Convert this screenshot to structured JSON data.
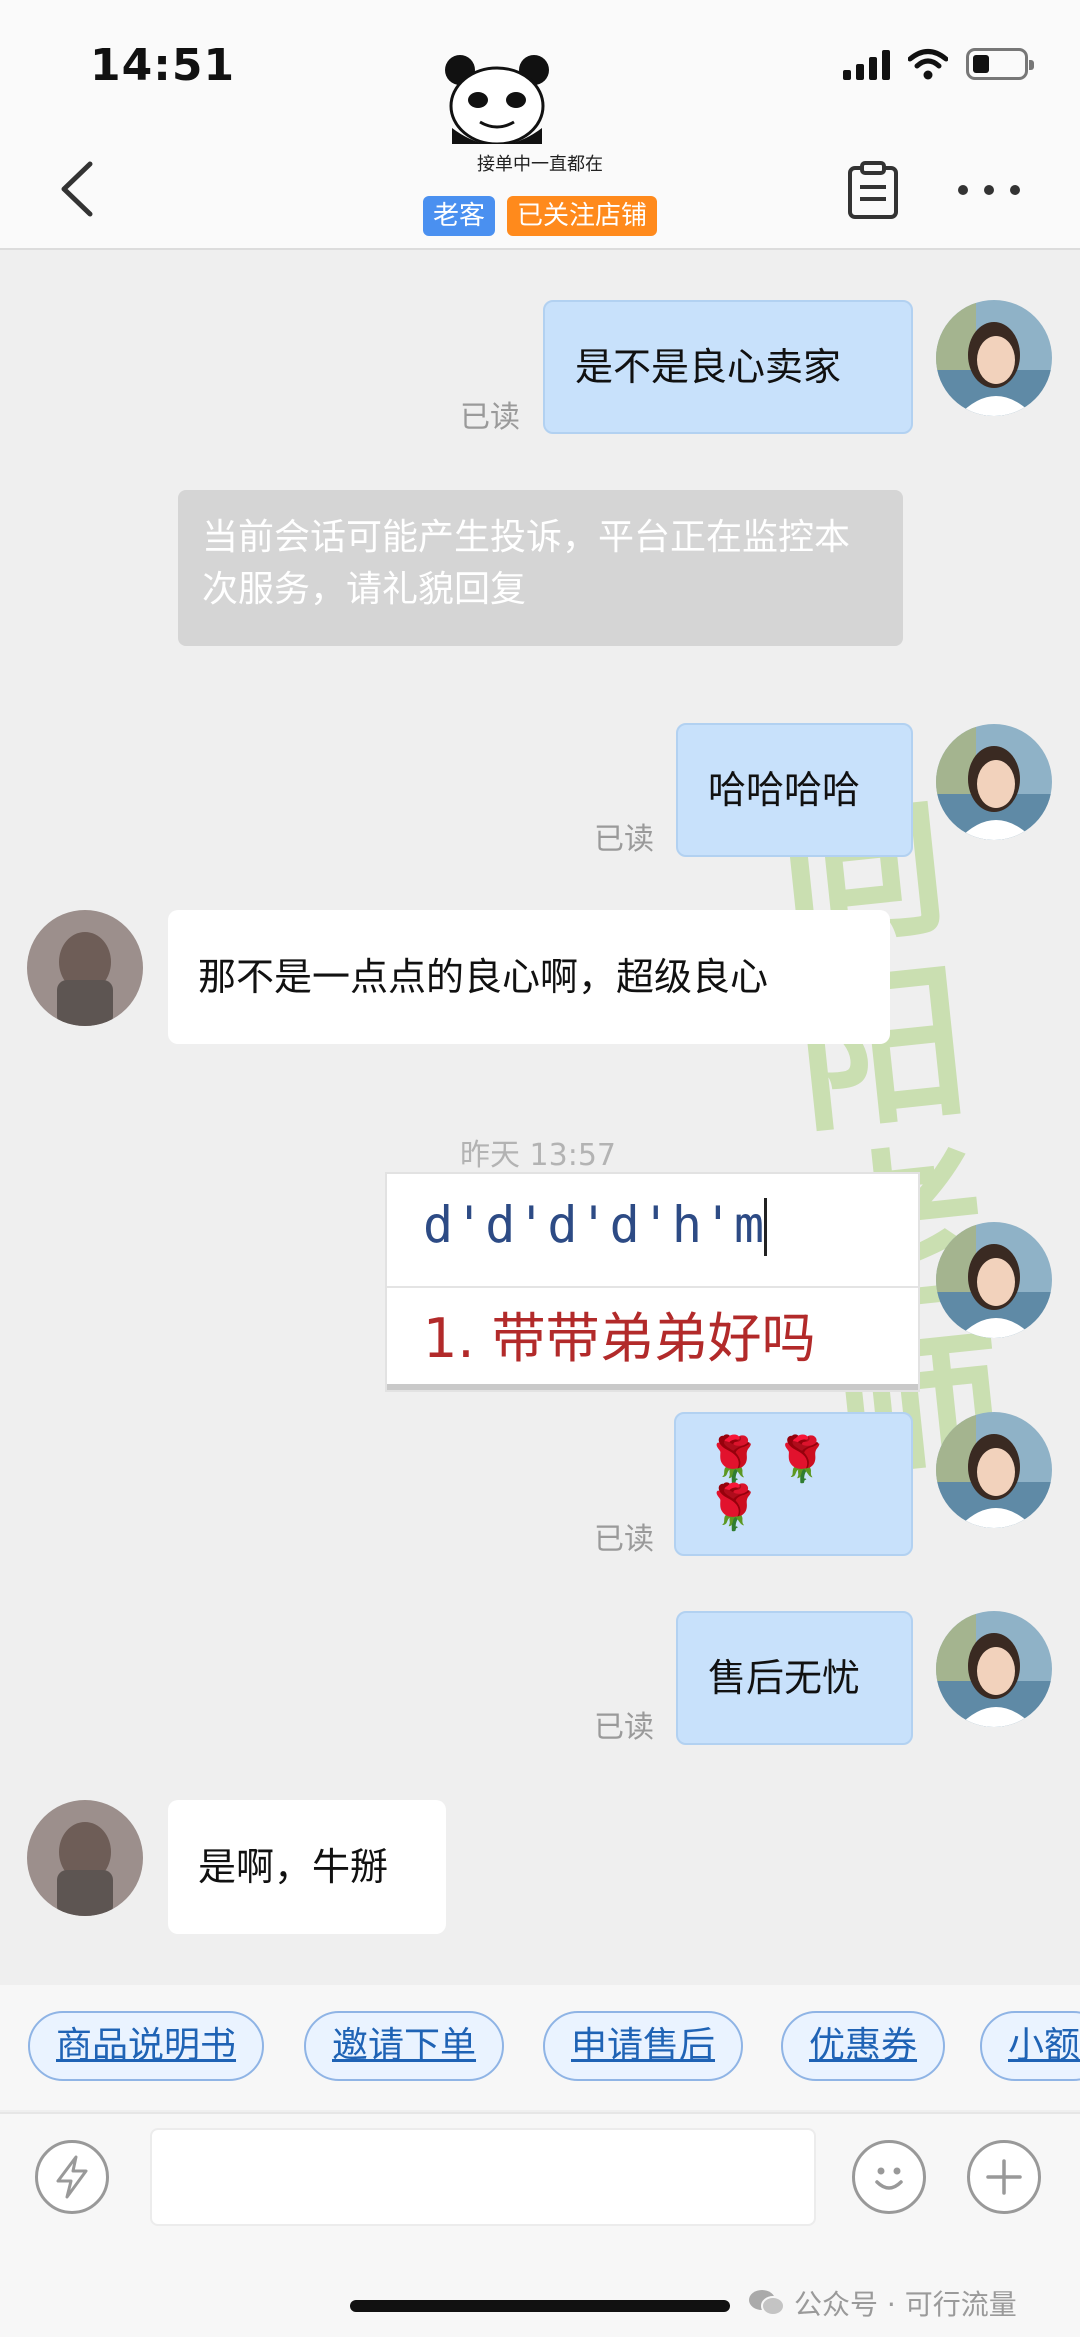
{
  "status_bar": {
    "time": "14:51"
  },
  "header": {
    "shop_name": "接单中一直都在",
    "tags": [
      "老客",
      "已关注店铺"
    ]
  },
  "messages": {
    "m1": {
      "text": "是不是良心卖家",
      "read": "已读"
    },
    "system_notice": "当前会话可能产生投诉，平台正在监控本次服务，请礼貌回复",
    "m2": {
      "text": "哈哈哈哈",
      "read": "已读"
    },
    "m3": {
      "text": "那不是一点点的良心啊，超级良心"
    },
    "timestamp": "昨天 13:57",
    "sticker": {
      "line1": "d'd'd'd'h'm",
      "line2": "1. 带带弟弟好吗"
    },
    "m4": {
      "text": "🌹 🌹 🌹",
      "read": "已读"
    },
    "m5": {
      "text": "售后无忧",
      "read": "已读"
    },
    "m6": {
      "text": "是啊，牛掰"
    }
  },
  "watermark": "向阳老师",
  "quick_actions": [
    "商品说明书",
    "邀请下单",
    "申请售后",
    "优惠券",
    "小额"
  ],
  "input": {
    "value": "",
    "placeholder": ""
  },
  "source_label": "公众号 · 可行流量",
  "colors": {
    "outgoing_bubble": "#c8e1fb",
    "tag_blue": "#4a90f0",
    "tag_orange": "#ff8a1c",
    "link_blue": "#1f63b5"
  },
  "icons": [
    "back-icon",
    "notes-icon",
    "more-icon",
    "lightning-icon",
    "emoji-icon",
    "plus-icon",
    "wechat-icon"
  ]
}
